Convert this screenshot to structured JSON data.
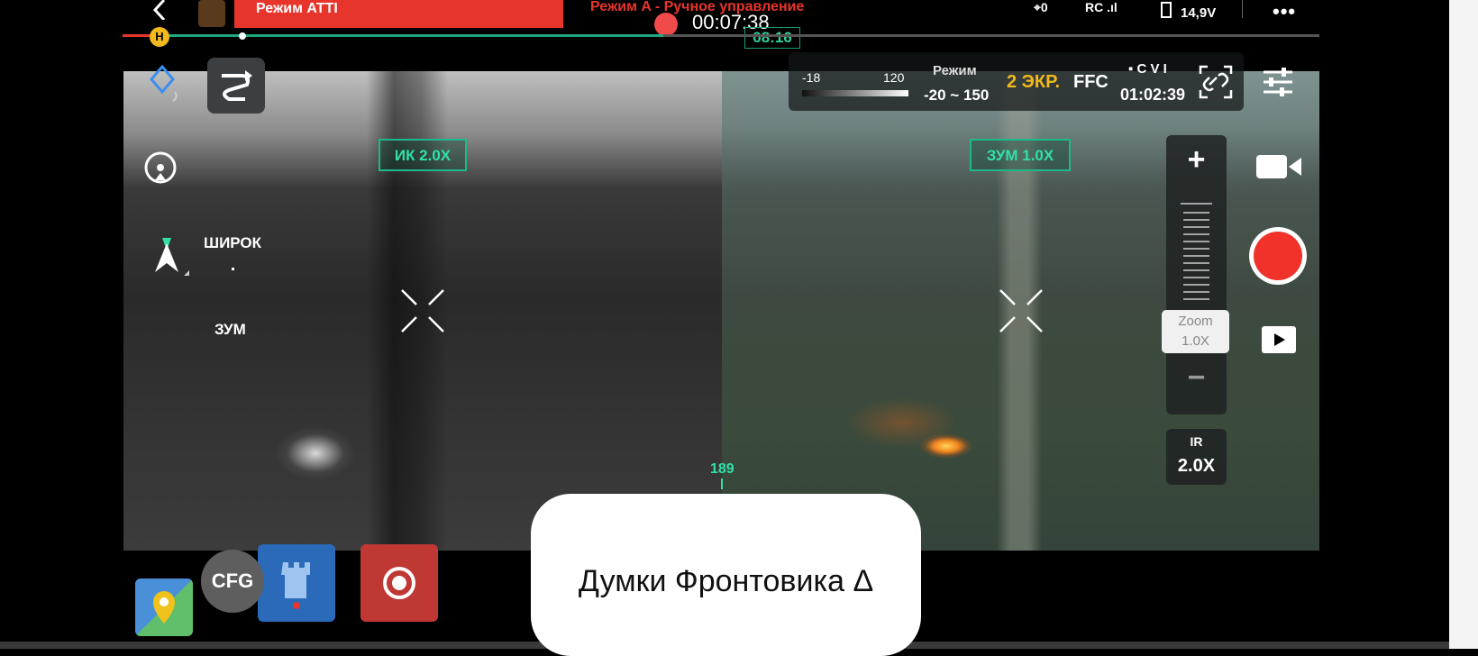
{
  "top_bar": {
    "flight_mode": "Режим ATTI",
    "control_mode": "Режим A - Ручное управление",
    "recording_time": "00:07:38",
    "total_time": "08:16",
    "gps_count": "0",
    "rc_label": "RC",
    "battery_voltage": "14,9V",
    "more_label": "•••",
    "home_marker": "H",
    "flight_progress": 0.45
  },
  "left_panel": {
    "lens_wide": "ШИРОК",
    "lens_zoom": "ЗУМ"
  },
  "views": {
    "ir_tag": "ИК 2.0X",
    "zoom_tag": "ЗУМ 1.0X"
  },
  "thermal_panel": {
    "temp_min": "-18",
    "temp_max": "120",
    "mode_label": "Режим",
    "mode_range": "-20 ~ 150",
    "screen_mode": "2 ЭКР.",
    "ffc": "FFC",
    "storage": "C V I",
    "storage_time": "01:02:39",
    "accent_color": "#f2b91c"
  },
  "zoom_control": {
    "plus": "+",
    "minus": "−",
    "tooltip_label": "Zoom",
    "tooltip_value": "1.0X",
    "ir_label": "IR",
    "ir_value": "2.0X"
  },
  "heading": "189",
  "bottom_bar": {
    "cfg_label": "CFG"
  },
  "watermark": {
    "channel": "Думки Фронтовика Δ"
  },
  "colors": {
    "mode_red": "#e8352c",
    "hud_green": "#32e0a8",
    "record_red": "#f0322a"
  }
}
